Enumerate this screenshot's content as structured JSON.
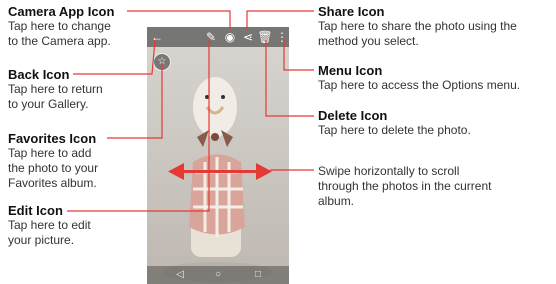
{
  "callouts": {
    "camera": {
      "title": "Camera App Icon",
      "desc1": "Tap here to change",
      "desc2": "to the Camera app."
    },
    "back": {
      "title": "Back Icon",
      "desc1": "Tap here to return",
      "desc2": "to your Gallery."
    },
    "favorites": {
      "title": "Favorites Icon",
      "desc1": "Tap here to add",
      "desc2": "the photo to your",
      "desc3": "Favorites album."
    },
    "edit": {
      "title": "Edit Icon",
      "desc1": "Tap here to edit",
      "desc2": "your picture."
    },
    "share": {
      "title": "Share Icon",
      "desc1": "Tap here to share the photo using the",
      "desc2": "method you select."
    },
    "menu": {
      "title": "Menu Icon",
      "desc1": "Tap here to access the Options menu."
    },
    "delete": {
      "title": "Delete Icon",
      "desc1": "Tap here to delete the photo."
    },
    "swipe": {
      "desc1": "Swipe horizontally to scroll",
      "desc2": "through the photos in the current",
      "desc3": "album."
    }
  },
  "phone": {
    "back_glyph": "←",
    "edit_glyph": "✎",
    "camera_glyph": "◉",
    "share_glyph": "⋖",
    "delete_glyph": "🗑",
    "menu_glyph": "⋮",
    "favorite_glyph": "☆",
    "nav_back_glyph": "◁",
    "nav_home_glyph": "○",
    "nav_recent_glyph": "□"
  },
  "colors": {
    "callout_line": "#e53935",
    "swipe_arrow": "#e53935"
  }
}
